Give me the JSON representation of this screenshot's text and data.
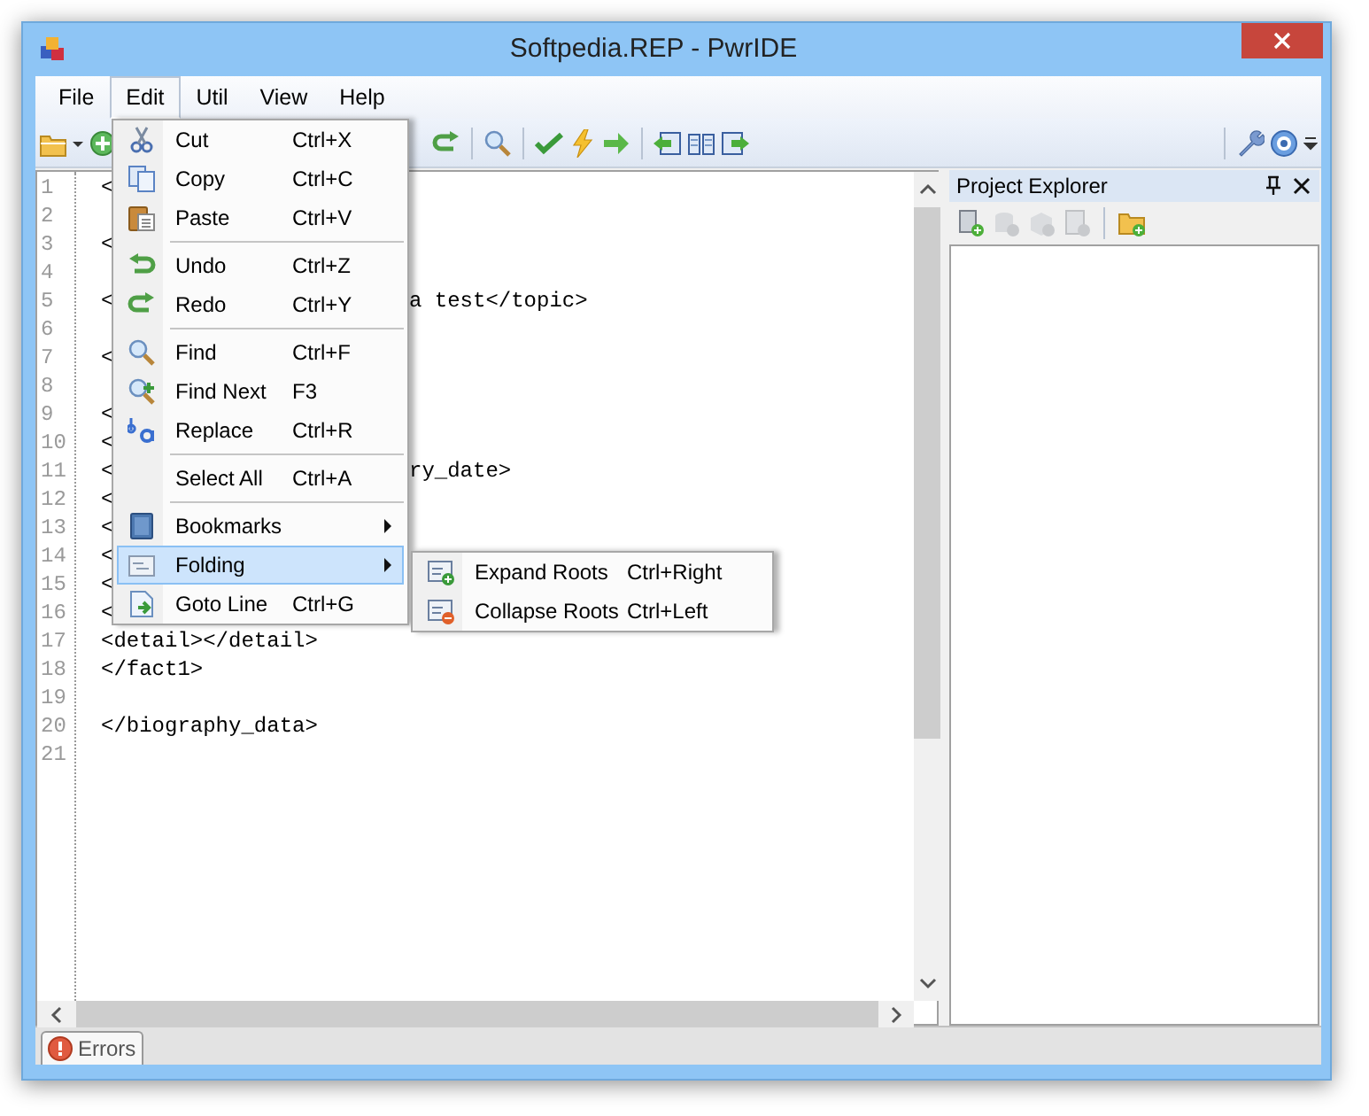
{
  "window": {
    "title": "Softpedia.REP - PwrIDE"
  },
  "menubar": [
    {
      "label": "File",
      "selected": false
    },
    {
      "label": "Edit",
      "selected": true
    },
    {
      "label": "Util",
      "selected": false
    },
    {
      "label": "View",
      "selected": false
    },
    {
      "label": "Help",
      "selected": false
    }
  ],
  "edit_menu": [
    {
      "kind": "item",
      "label": "Cut",
      "shortcut": "Ctrl+X",
      "selected": false
    },
    {
      "kind": "item",
      "label": "Copy",
      "shortcut": "Ctrl+C",
      "selected": false
    },
    {
      "kind": "item",
      "label": "Paste",
      "shortcut": "Ctrl+V",
      "selected": false
    },
    {
      "kind": "separator"
    },
    {
      "kind": "item",
      "label": "Undo",
      "shortcut": "Ctrl+Z",
      "selected": false
    },
    {
      "kind": "item",
      "label": "Redo",
      "shortcut": "Ctrl+Y",
      "selected": false
    },
    {
      "kind": "separator"
    },
    {
      "kind": "item",
      "label": "Find",
      "shortcut": "Ctrl+F",
      "selected": false
    },
    {
      "kind": "item",
      "label": "Find Next",
      "shortcut": "F3",
      "selected": false
    },
    {
      "kind": "item",
      "label": "Replace",
      "shortcut": "Ctrl+R",
      "selected": false
    },
    {
      "kind": "separator"
    },
    {
      "kind": "item",
      "label": "Select All",
      "shortcut": "Ctrl+A",
      "selected": false
    },
    {
      "kind": "separator"
    },
    {
      "kind": "submenu",
      "label": "Bookmarks",
      "selected": false
    },
    {
      "kind": "submenu",
      "label": "Folding",
      "selected": true
    },
    {
      "kind": "item",
      "label": "Goto Line",
      "shortcut": "Ctrl+G",
      "selected": false
    }
  ],
  "folding_submenu": [
    {
      "label": "Expand Roots",
      "shortcut": "Ctrl+Right",
      "selected": false
    },
    {
      "label": "Collapse Roots",
      "shortcut": "Ctrl+Left",
      "selected": false
    }
  ],
  "editor": {
    "lines": [
      {
        "number": "1",
        "text": "<"
      },
      {
        "number": "2"
      },
      {
        "number": "3",
        "text": "<"
      },
      {
        "number": "4"
      },
      {
        "number": "5",
        "text": "<",
        "tail": "a test</topic>"
      },
      {
        "number": "6"
      },
      {
        "number": "7",
        "text": "<"
      },
      {
        "number": "8"
      },
      {
        "number": "9",
        "text": "<"
      },
      {
        "number": "10",
        "text": "<"
      },
      {
        "number": "11",
        "text": "<",
        "tail": "ry_date>"
      },
      {
        "number": "12",
        "text": "<"
      },
      {
        "number": "13",
        "text": "<"
      },
      {
        "number": "14",
        "text": "<"
      },
      {
        "number": "15",
        "text": "<"
      },
      {
        "number": "16",
        "text": "<"
      },
      {
        "number": "17",
        "text": "<detail></detail>"
      },
      {
        "number": "18",
        "text": "</fact1>"
      },
      {
        "number": "19"
      },
      {
        "number": "20",
        "text": "</biography_data>"
      },
      {
        "number": "21"
      }
    ]
  },
  "project_explorer": {
    "title": "Project Explorer"
  },
  "bottom_tabs": [
    {
      "label": "Errors",
      "selected": true
    }
  ]
}
